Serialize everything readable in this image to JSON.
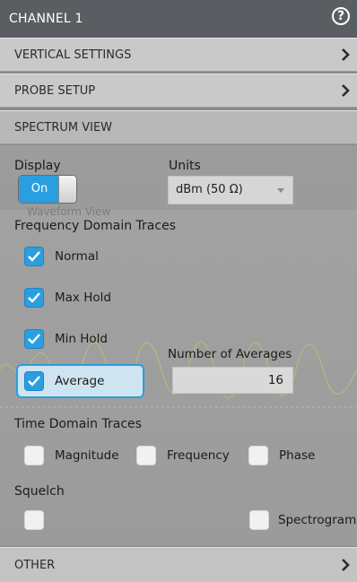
{
  "header": {
    "title": "CHANNEL 1",
    "help": "?"
  },
  "sections": {
    "vertical_settings": "VERTICAL SETTINGS",
    "probe_setup": "PROBE SETUP",
    "spectrum_view": "SPECTRUM VIEW",
    "other": "OTHER"
  },
  "display": {
    "label": "Display",
    "toggle": "On"
  },
  "units": {
    "label": "Units",
    "selected": "dBm (50 Ω)"
  },
  "background_label": "Waveform View",
  "frequency_domain": {
    "label": "Frequency Domain Traces",
    "normal": "Normal",
    "max_hold": "Max Hold",
    "min_hold": "Min Hold",
    "average": "Average"
  },
  "averages": {
    "label": "Number of Averages",
    "value": "16"
  },
  "time_domain": {
    "label": "Time Domain Traces",
    "magnitude": "Magnitude",
    "frequency": "Frequency",
    "phase": "Phase"
  },
  "squelch": {
    "label": "Squelch"
  },
  "spectrogram": {
    "label": "Spectrogram"
  },
  "colors": {
    "accent": "#2a9fe0",
    "header": "#5a5d61"
  }
}
